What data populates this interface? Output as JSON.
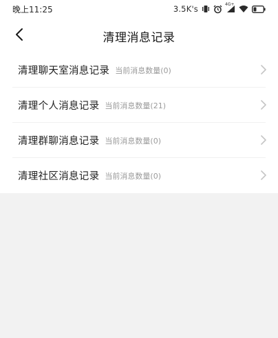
{
  "status_bar": {
    "time": "晚上11:25",
    "speed": "3.5K's",
    "network": "4G+",
    "icons": [
      "vibrate-icon",
      "alarm-icon",
      "cellular-signal-icon",
      "wifi-icon",
      "battery-icon"
    ]
  },
  "header": {
    "back_icon": "chevron-left-icon",
    "title": "清理消息记录"
  },
  "items": [
    {
      "label": "清理聊天室消息记录",
      "count": "当前消息数量(0)"
    },
    {
      "label": "清理个人消息记录",
      "count": "当前消息数量(21)"
    },
    {
      "label": "清理群聊消息记录",
      "count": "当前消息数量(0)"
    },
    {
      "label": "清理社区消息记录",
      "count": "当前消息数量(0)"
    }
  ],
  "colors": {
    "background": "#f2f2f2",
    "surface": "#ffffff",
    "text_primary": "#222222",
    "text_secondary": "#9a9a9a",
    "chevron": "#c4c4c4"
  }
}
